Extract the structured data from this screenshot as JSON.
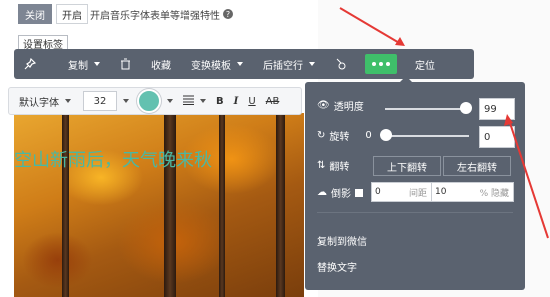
{
  "top": {
    "toggle_off": "关闭",
    "toggle_on": "开启",
    "hint": "开启音乐字体表单等增强特性",
    "help_icon": "question-icon",
    "settings_tag": "设置标签"
  },
  "headline": "空山新雨后，天气晚来秋",
  "toolbar": {
    "pin_icon": "pin-icon",
    "copy": "复制",
    "delete_icon": "trash-icon",
    "favorite": "收藏",
    "template": "变换模板",
    "blank_after": "后插空行",
    "pointer_icon": "pointer-icon",
    "more_icon": "more-icon",
    "locate": "定位"
  },
  "format": {
    "font": "默认字体",
    "size": "32",
    "color": "#63c1b0",
    "align_icon": "align-icon",
    "bold": "B",
    "italic": "I",
    "underline": "U",
    "strike": "AB"
  },
  "panel": {
    "opacity_label": "透明度",
    "opacity_value": "99",
    "opacity_level": 0.99,
    "rotate_label": "旋转",
    "rotate_min": "0",
    "rotate_value": "0",
    "flip_label": "翻转",
    "flip_vertical": "上下翻转",
    "flip_horizontal": "左右翻转",
    "shadow_label": "倒影",
    "shadow_gap_value": "0",
    "shadow_gap_unit": "间距",
    "shadow_hide_value": "10",
    "shadow_hide_unit": "% 隐藏",
    "copy_to_wechat": "复制到微信",
    "replace_text": "替换文字"
  },
  "colors": {
    "toolbar_bg": "#5a626f",
    "more_btn": "#3fbf6a",
    "annotation": "#e53935",
    "headline": "#4ab8a3"
  }
}
